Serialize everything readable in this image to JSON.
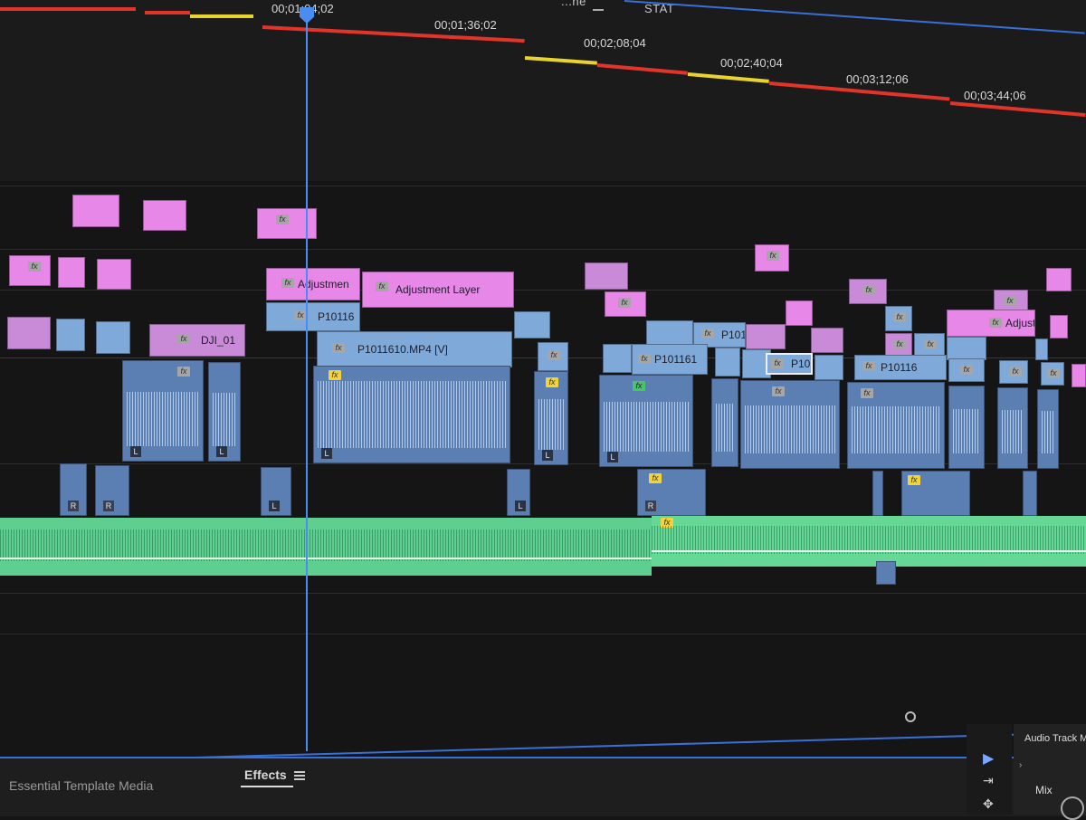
{
  "header": {
    "tab_partial": "...ne",
    "stat_label": "STAT"
  },
  "ruler": {
    "playhead_time": "00;01;04;02",
    "ticks": [
      "00;01;36;02",
      "00;02;08;04",
      "00;02;40;04",
      "00;03;12;06",
      "00;03;44;06"
    ]
  },
  "clips": {
    "adjustment_short": "Adjustmen",
    "adjustment_layer": "Adjustment Layer",
    "adjustment_right": "Adjustm",
    "p10116": "P10116",
    "dji": "DJI_01",
    "p1011610": "P1011610.MP4 [V]",
    "p101161": "P101161",
    "p101": "P101",
    "p101_selected": "P101",
    "p10116_b": "P10116",
    "fx": "fx",
    "l_tag": "L",
    "r_tag": "R"
  },
  "bottom_tabs": {
    "essential_template": "Essential Template Media",
    "effects": "Effects"
  },
  "audio_track_mixer": {
    "title": "Audio Track Mixer",
    "mode": "Mix"
  },
  "colors": {
    "pink_clip": "#e787e7",
    "video_clip": "#7fa9d8",
    "audio_clip": "#5b7fb3",
    "music_track": "#5fcf8f",
    "playhead": "#4a8cf0"
  }
}
